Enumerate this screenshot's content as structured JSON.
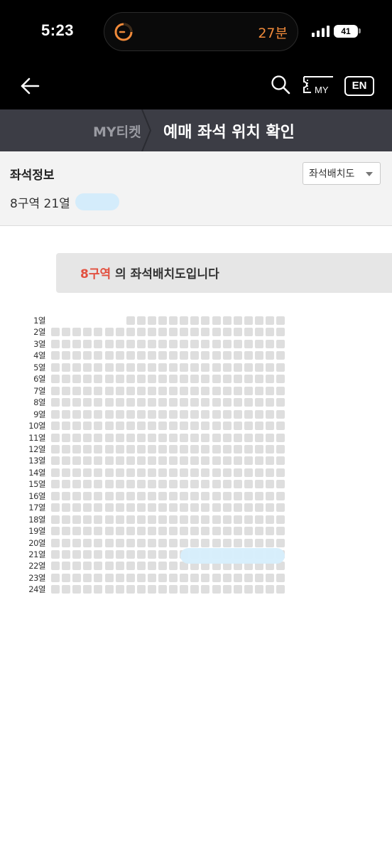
{
  "status_bar": {
    "time": "5:23",
    "island_text": "27분",
    "battery_level": "41",
    "island_accent": "#f08a3a"
  },
  "header": {
    "lang_label": "EN",
    "ticket_label": "MY",
    "icons": [
      "back-arrow-icon",
      "search-icon",
      "my-ticket-icon"
    ]
  },
  "breadcrumb": {
    "parent": "MY티켓",
    "current": "예매 좌석 위치 확인"
  },
  "seat_info": {
    "title": "좌석정보",
    "detail": "8구역 21열",
    "dropdown_label": "좌석배치도"
  },
  "banner": {
    "area": "8구역",
    "suffix": " 의 좌석배치도입니다",
    "area_color": "#e2503f"
  },
  "seat_map": {
    "rows": [
      {
        "label": "1열",
        "from": 7,
        "to": 21
      },
      {
        "label": "2열",
        "from": 0,
        "to": 21
      },
      {
        "label": "3열",
        "from": 0,
        "to": 21
      },
      {
        "label": "4열",
        "from": 0,
        "to": 21
      },
      {
        "label": "5열",
        "from": 0,
        "to": 21
      },
      {
        "label": "6열",
        "from": 0,
        "to": 21
      },
      {
        "label": "7열",
        "from": 0,
        "to": 21
      },
      {
        "label": "8열",
        "from": 0,
        "to": 21
      },
      {
        "label": "9열",
        "from": 0,
        "to": 21
      },
      {
        "label": "10열",
        "from": 0,
        "to": 21
      },
      {
        "label": "11열",
        "from": 0,
        "to": 21
      },
      {
        "label": "12열",
        "from": 0,
        "to": 21
      },
      {
        "label": "13열",
        "from": 0,
        "to": 21
      },
      {
        "label": "14열",
        "from": 0,
        "to": 21
      },
      {
        "label": "15열",
        "from": 0,
        "to": 21
      },
      {
        "label": "16열",
        "from": 0,
        "to": 21
      },
      {
        "label": "17열",
        "from": 0,
        "to": 21
      },
      {
        "label": "18열",
        "from": 0,
        "to": 21
      },
      {
        "label": "19열",
        "from": 0,
        "to": 21
      },
      {
        "label": "20열",
        "from": 0,
        "to": 21
      },
      {
        "label": "21열",
        "from": 0,
        "to": 21
      },
      {
        "label": "22열",
        "from": 0,
        "to": 21
      },
      {
        "label": "23열",
        "from": 0,
        "to": 21
      },
      {
        "label": "24열",
        "from": 0,
        "to": 21
      }
    ],
    "seat_color": "#dedede"
  }
}
